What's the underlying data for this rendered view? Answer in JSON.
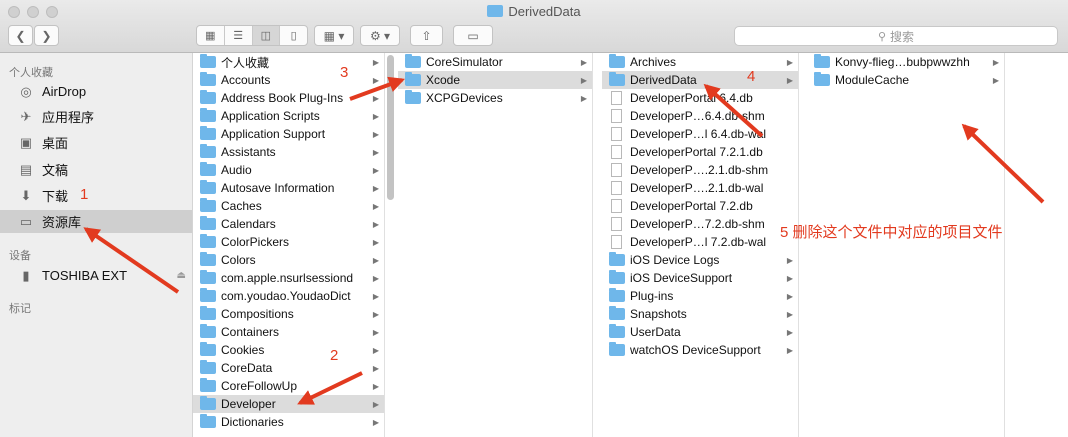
{
  "window": {
    "title": "DerivedData"
  },
  "toolbar": {
    "search_placeholder": "搜索"
  },
  "sidebar": {
    "favorites_header": "个人收藏",
    "favorites": [
      {
        "label": "AirDrop",
        "icon": "airdrop-icon"
      },
      {
        "label": "应用程序",
        "icon": "applications-icon"
      },
      {
        "label": "桌面",
        "icon": "desktop-icon"
      },
      {
        "label": "文稿",
        "icon": "documents-icon"
      },
      {
        "label": "下载",
        "icon": "downloads-icon"
      },
      {
        "label": "资源库",
        "icon": "folder-icon",
        "selected": true
      }
    ],
    "devices_header": "设备",
    "devices": [
      {
        "label": "TOSHIBA EXT",
        "icon": "drive-icon"
      }
    ],
    "tags_header": "标记"
  },
  "columns": [
    {
      "items": [
        {
          "label": "个人收藏",
          "type": "folder",
          "arrow": true
        },
        {
          "label": "Accounts",
          "type": "folder",
          "arrow": true
        },
        {
          "label": "Address Book Plug-Ins",
          "type": "folder",
          "arrow": true
        },
        {
          "label": "Application Scripts",
          "type": "folder",
          "arrow": true
        },
        {
          "label": "Application Support",
          "type": "folder",
          "arrow": true
        },
        {
          "label": "Assistants",
          "type": "folder",
          "arrow": true
        },
        {
          "label": "Audio",
          "type": "folder",
          "arrow": true
        },
        {
          "label": "Autosave Information",
          "type": "folder",
          "arrow": true
        },
        {
          "label": "Caches",
          "type": "folder",
          "arrow": true
        },
        {
          "label": "Calendars",
          "type": "folder",
          "arrow": true
        },
        {
          "label": "ColorPickers",
          "type": "folder",
          "arrow": true
        },
        {
          "label": "Colors",
          "type": "folder",
          "arrow": true
        },
        {
          "label": "com.apple.nsurlsessiond",
          "type": "folder",
          "arrow": true
        },
        {
          "label": "com.youdao.YoudaoDict",
          "type": "folder",
          "arrow": true
        },
        {
          "label": "Compositions",
          "type": "folder",
          "arrow": true
        },
        {
          "label": "Containers",
          "type": "folder",
          "arrow": true
        },
        {
          "label": "Cookies",
          "type": "folder",
          "arrow": true
        },
        {
          "label": "CoreData",
          "type": "folder",
          "arrow": true
        },
        {
          "label": "CoreFollowUp",
          "type": "folder",
          "arrow": true
        },
        {
          "label": "Developer",
          "type": "folder",
          "arrow": true,
          "selected": true
        },
        {
          "label": "Dictionaries",
          "type": "folder",
          "arrow": true
        }
      ]
    },
    {
      "items": [
        {
          "label": "CoreSimulator",
          "type": "folder",
          "arrow": true
        },
        {
          "label": "Xcode",
          "type": "folder",
          "arrow": true,
          "selected": true
        },
        {
          "label": "XCPGDevices",
          "type": "folder",
          "arrow": true
        }
      ]
    },
    {
      "items": [
        {
          "label": "Archives",
          "type": "folder",
          "arrow": true
        },
        {
          "label": "DerivedData",
          "type": "folder",
          "arrow": true,
          "selected": true
        },
        {
          "label": "DeveloperPortal 6.4.db",
          "type": "file"
        },
        {
          "label": "DeveloperP…6.4.db-shm",
          "type": "file"
        },
        {
          "label": "DeveloperP…l 6.4.db-wal",
          "type": "file"
        },
        {
          "label": "DeveloperPortal 7.2.1.db",
          "type": "file"
        },
        {
          "label": "DeveloperP….2.1.db-shm",
          "type": "file"
        },
        {
          "label": "DeveloperP….2.1.db-wal",
          "type": "file"
        },
        {
          "label": "DeveloperPortal 7.2.db",
          "type": "file"
        },
        {
          "label": "DeveloperP…7.2.db-shm",
          "type": "file"
        },
        {
          "label": "DeveloperP…l 7.2.db-wal",
          "type": "file"
        },
        {
          "label": "iOS Device Logs",
          "type": "folder",
          "arrow": true
        },
        {
          "label": "iOS DeviceSupport",
          "type": "folder",
          "arrow": true
        },
        {
          "label": "Plug-ins",
          "type": "folder",
          "arrow": true
        },
        {
          "label": "Snapshots",
          "type": "folder",
          "arrow": true
        },
        {
          "label": "UserData",
          "type": "folder",
          "arrow": true
        },
        {
          "label": "watchOS DeviceSupport",
          "type": "folder",
          "arrow": true
        }
      ]
    },
    {
      "items": [
        {
          "label": "Konvy-flieg…bubpwwzhh",
          "type": "folder",
          "arrow": true
        },
        {
          "label": "ModuleCache",
          "type": "folder",
          "arrow": true
        }
      ]
    }
  ],
  "annotations": [
    {
      "label": "1"
    },
    {
      "label": "2"
    },
    {
      "label": "3"
    },
    {
      "label": "4"
    },
    {
      "label": "5 删除这个文件中对应的项目文件"
    }
  ],
  "colors": {
    "annotation": "#e23a1f",
    "folder": "#6fb7ea",
    "selection": "#dcdcdc"
  }
}
